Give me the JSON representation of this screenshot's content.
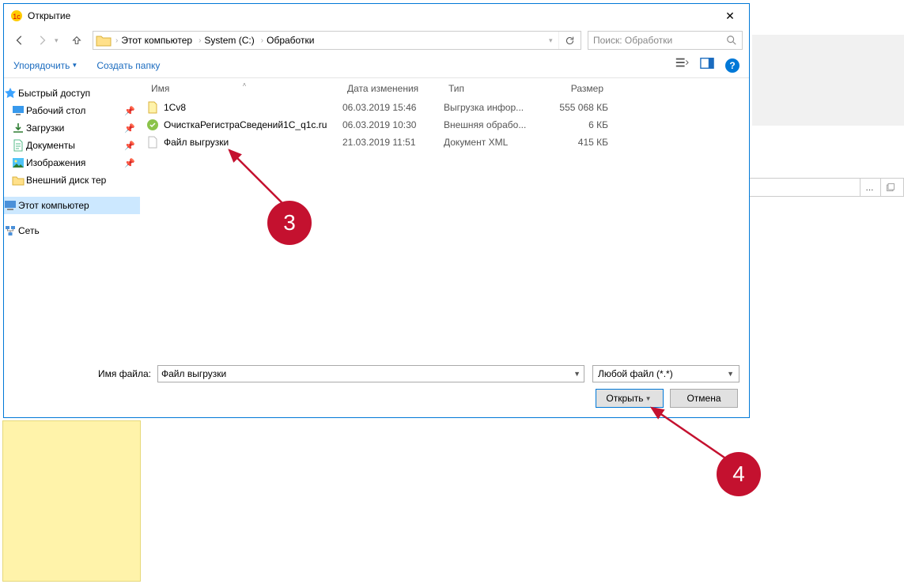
{
  "dialog": {
    "title": "Открытие",
    "breadcrumb": [
      "Этот компьютер",
      "System (C:)",
      "Обработки"
    ],
    "search_placeholder": "Поиск: Обработки",
    "organize": "Упорядочить",
    "new_folder": "Создать папку"
  },
  "nav": {
    "quick": "Быстрый доступ",
    "desktop": "Рабочий стол",
    "downloads": "Загрузки",
    "documents": "Документы",
    "pictures": "Изображения",
    "ext_disk": "Внешний диск тер",
    "this_pc": "Этот компьютер",
    "network": "Сеть"
  },
  "columns": {
    "name": "Имя",
    "date": "Дата изменения",
    "type": "Тип",
    "size": "Размер"
  },
  "files": [
    {
      "name": "1Cv8",
      "date": "06.03.2019 15:46",
      "type": "Выгрузка инфор...",
      "size": "555 068 КБ"
    },
    {
      "name": "ОчисткаРегистраСведений1С_q1c.ru",
      "date": "06.03.2019 10:30",
      "type": "Внешняя обрабо...",
      "size": "6 КБ"
    },
    {
      "name": "Файл выгрузки",
      "date": "21.03.2019 11:51",
      "type": "Документ XML",
      "size": "415 КБ"
    }
  ],
  "footer": {
    "filename_label": "Имя файла:",
    "filename_value": "Файл выгрузки",
    "filetype": "Любой файл (*.*)",
    "open": "Открыть",
    "cancel": "Отмена"
  },
  "callouts": {
    "c3": "3",
    "c4": "4"
  },
  "bg": {
    "dots": "..."
  }
}
